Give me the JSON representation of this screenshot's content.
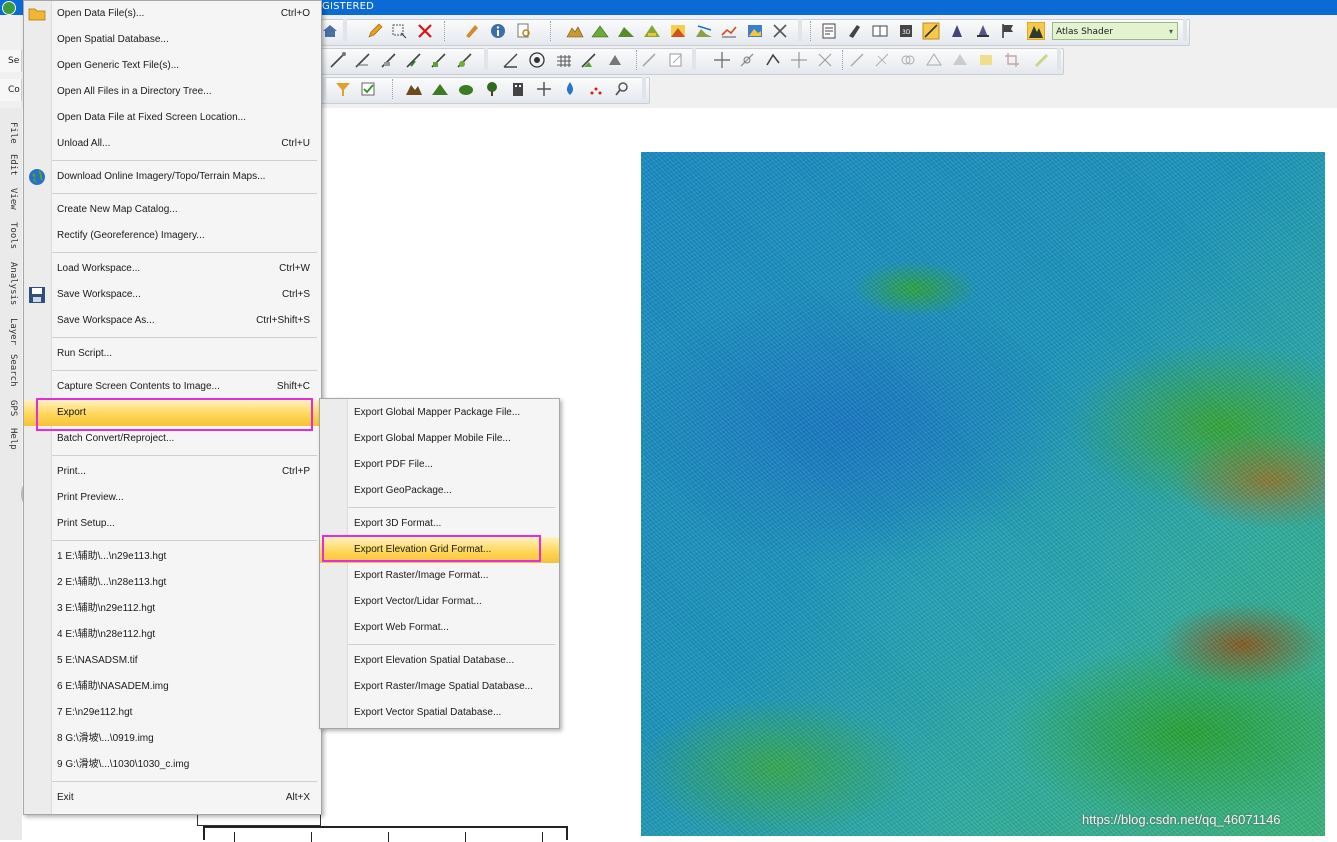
{
  "window": {
    "title_fragment": "GISTERED"
  },
  "toolbar": {
    "shader_combo": "Atlas Shader",
    "left_stubs": [
      "Se",
      "Co"
    ]
  },
  "dock_tabs": [
    "File",
    "Edit",
    "View",
    "Tools",
    "Analysis",
    "Layer",
    "Search",
    "GPS",
    "Help"
  ],
  "file_menu": {
    "groups": [
      [
        {
          "label": "Open Data File(s)...",
          "shortcut": "Ctrl+O"
        },
        {
          "label": "Open Spatial Database...",
          "shortcut": ""
        },
        {
          "label": "Open Generic Text File(s)...",
          "shortcut": ""
        },
        {
          "label": "Open All Files in a Directory Tree...",
          "shortcut": ""
        },
        {
          "label": "Open Data File at Fixed Screen Location...",
          "shortcut": ""
        },
        {
          "label": "Unload All...",
          "shortcut": "Ctrl+U"
        }
      ],
      [
        {
          "label": "Download Online Imagery/Topo/Terrain Maps...",
          "shortcut": ""
        }
      ],
      [
        {
          "label": "Create New Map Catalog...",
          "shortcut": ""
        },
        {
          "label": "Rectify (Georeference) Imagery...",
          "shortcut": ""
        }
      ],
      [
        {
          "label": "Load Workspace...",
          "shortcut": "Ctrl+W"
        },
        {
          "label": "Save Workspace...",
          "shortcut": "Ctrl+S"
        },
        {
          "label": "Save Workspace As...",
          "shortcut": "Ctrl+Shift+S"
        }
      ],
      [
        {
          "label": "Run Script...",
          "shortcut": ""
        }
      ],
      [
        {
          "label": "Capture Screen Contents to Image...",
          "shortcut": "Shift+C"
        },
        {
          "label": "Export",
          "shortcut": ""
        },
        {
          "label": "Batch Convert/Reproject...",
          "shortcut": ""
        }
      ],
      [
        {
          "label": "Print...",
          "shortcut": "Ctrl+P"
        },
        {
          "label": "Print Preview...",
          "shortcut": ""
        },
        {
          "label": "Print Setup...",
          "shortcut": ""
        }
      ],
      [
        {
          "label": "1 E:\\辅助\\...\\n29e113.hgt",
          "shortcut": ""
        },
        {
          "label": "2 E:\\辅助\\...\\n28e113.hgt",
          "shortcut": ""
        },
        {
          "label": "3 E:\\辅助\\n29e112.hgt",
          "shortcut": ""
        },
        {
          "label": "4 E:\\辅助\\n28e112.hgt",
          "shortcut": ""
        },
        {
          "label": "5 E:\\NASADSM.tif",
          "shortcut": ""
        },
        {
          "label": "6 E:\\辅助\\NASADEM.img",
          "shortcut": ""
        },
        {
          "label": "7 E:\\n29e112.hgt",
          "shortcut": ""
        },
        {
          "label": "8 G:\\滑坡\\...\\0919.img",
          "shortcut": ""
        },
        {
          "label": "9 G:\\滑坡\\...\\1030\\1030_c.img",
          "shortcut": ""
        }
      ],
      [
        {
          "label": "Exit",
          "shortcut": "Alt+X"
        }
      ]
    ]
  },
  "export_submenu": {
    "groups": [
      [
        "Export Global Mapper Package File...",
        "Export Global Mapper Mobile File...",
        "Export PDF File...",
        "Export GeoPackage..."
      ],
      [
        "Export 3D Format...",
        "Export Elevation Grid Format...",
        "Export Raster/Image Format...",
        "Export Vector/Lidar Format...",
        "Export Web Format..."
      ],
      [
        "Export Elevation Spatial Database...",
        "Export Raster/Image Spatial Database...",
        "Export Vector Spatial Database..."
      ]
    ]
  },
  "watermark": "https://blog.csdn.net/qq_46071146",
  "colors": {
    "titlebar": "#0a6ad6",
    "highlight": "#ffd75a",
    "annotation": "#e42de0"
  }
}
